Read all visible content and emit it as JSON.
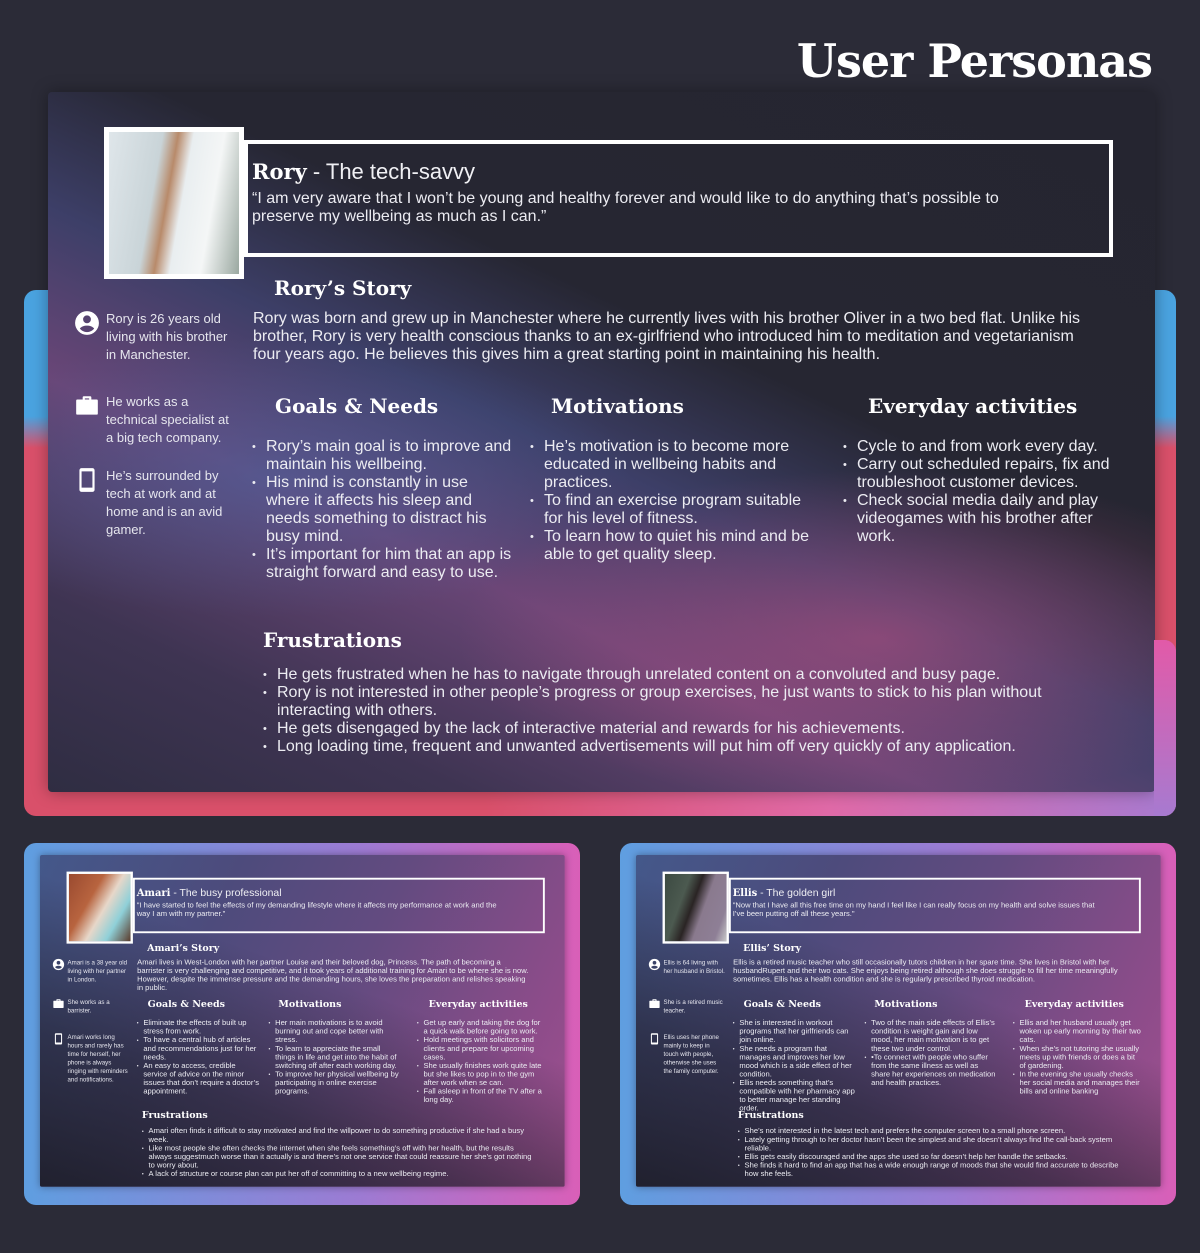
{
  "title": "User Personas",
  "personas": [
    {
      "name": "Rory",
      "tagline": " - The tech-savvy",
      "quote": "“I am very aware that I won’t be young and healthy forever and would like to do anything that’s possible to preserve my wellbeing as much as I can.”",
      "story_title": "Rory’s Story",
      "story": "Rory was born and grew up in Manchester where he currently lives with his brother Oliver in a two bed flat. Unlike his brother, Rory is very health conscious thanks to an ex-girlfriend who introduced him to meditation and vegetarianism four years ago. He believes this gives him a great starting point in maintaining his health.",
      "facts": [
        {
          "icon": "user-circle-icon",
          "text": "Rory is 26 years old living with his brother in Manchester."
        },
        {
          "icon": "briefcase-icon",
          "text": "He works as a technical specialist at a big tech company."
        },
        {
          "icon": "phone-icon",
          "text": "He’s surrounded by tech at work and at home and is an avid gamer."
        }
      ],
      "goals_title": "Goals & Needs",
      "goals": [
        "Rory’s main goal is to improve and maintain his wellbeing.",
        "His mind is constantly in use where it affects his sleep and needs something to distract his busy mind.",
        "It’s important for him that an app is straight forward and easy to use."
      ],
      "motivations_title": "Motivations",
      "motivations": [
        "He’s motivation is to become more educated in wellbeing habits and practices.",
        "To find an exercise program suitable for his level of fitness.",
        "To learn how to quiet his mind and be able to get quality sleep."
      ],
      "activities_title": "Everyday activities",
      "activities": [
        "Cycle to and from work every day.",
        "Carry out scheduled repairs, fix and troubleshoot customer devices.",
        "Check social media daily and play videogames with his brother after work."
      ],
      "frustrations_title": "Frustrations",
      "frustrations": [
        "He gets frustrated when he has to navigate through unrelated content on a convoluted and busy page.",
        "Rory is not interested in other people’s progress or group exercises, he just wants to stick to his plan without interacting with others.",
        "He gets disengaged by the lack of interactive material and rewards for his achievements.",
        "Long loading time, frequent and unwanted advertisements will put him off very quickly of any application."
      ]
    },
    {
      "name": "Amari",
      "tagline": " - The busy professional",
      "quote": "\"I have started to feel the effects of my demanding lifestyle where it affects my performance at work and the way I am with my partner.\"",
      "story_title": "Amari’s Story",
      "story": "Amari lives in West-London with her partner Louise and their beloved dog, Princess. The path of becoming a barrister is very challenging and competitive, and it took years of additional training for Amari to be where she is now. However, despite the immense pressure and the demanding hours, she loves the preparation and relishes speaking in public.",
      "facts": [
        {
          "icon": "user-circle-icon",
          "text": "Amari is a 38 year old living with her partner in London."
        },
        {
          "icon": "briefcase-icon",
          "text": "She works as a barrister."
        },
        {
          "icon": "phone-icon",
          "text": "Amari works long hours and rarely has time for herself, her phone is always ringing with reminders and notifications."
        }
      ],
      "goals_title": "Goals & Needs",
      "goals": [
        "Eliminate the effects of built up stress from work.",
        "To have a central hub of articles and recommendations just for her needs.",
        "An easy to access, credible service of advice on the minor issues that don’t require a doctor’s appointment."
      ],
      "motivations_title": "Motivations",
      "motivations": [
        "Her main motivations is to avoid burning out and cope better with stress.",
        "To learn to appreciate the small things in life and get into the habit of switching off after each working day.",
        "To improve her physical wellbeing by participating in online exercise programs."
      ],
      "activities_title": "Everyday activities",
      "activities": [
        "Get up early and taking the dog for a quick walk before going to work.",
        "Hold meetings with solicitors and clients and prepare for upcoming cases.",
        "She usually finishes work quite late but she likes to pop in to the gym after work when se can.",
        "Fall asleep in front of the TV after a long day."
      ],
      "frustrations_title": "Frustrations",
      "frustrations": [
        "Amari often finds it difficult to stay motivated and find the willpower to do something productive if she had a busy week.",
        "Like most people she often checks the internet when she feels something’s off with her health, but the results always suggestmuch worse than it actually is and there’s not one service that could reassure her she’s got nothing to worry about.",
        "A lack of structure or course plan can put her off of committing to a new wellbeing regime."
      ]
    },
    {
      "name": "Ellis",
      "tagline": " - The golden girl",
      "quote": "\"Now that I have all this free time on my hand I feel like I can really focus on my health and solve issues that I’ve been putting off all these years.\"",
      "story_title": "Ellis’ Story",
      "story": "Ellis is a retired music teacher who still occasionally tutors children in her spare time. She lives in Bristol with her husbandRupert and their two cats. She enjoys being retired although she does struggle to fill her time meaningfully sometimes. Ellis has a health condition and she is regularly prescribed thyroid medication.",
      "facts": [
        {
          "icon": "user-circle-icon",
          "text": "Ellis is 64 living with her husband in Bristol."
        },
        {
          "icon": "briefcase-icon",
          "text": "She is a retired music teacher."
        },
        {
          "icon": "phone-icon",
          "text": "Ellis uses her phone mainly to keep in touch with people, otherwise she uses the family computer."
        }
      ],
      "goals_title": "Goals & Needs",
      "goals": [
        "She is interested in workout programs that her girlfriends can join online.",
        "She needs a program that manages and improves her low mood which is a side effect of her condition.",
        "Ellis needs something that’s compatible with her pharmacy app to better manage her standing order."
      ],
      "motivations_title": "Motivations",
      "motivations": [
        "Two of the main side effects of Ellis’s condition is weight gain and low mood, her main motivation is to get these two under control.",
        "•To connect with people who suffer from the same illness as well as share her experiences on medication and health practices."
      ],
      "activities_title": "Everyday activities",
      "activities": [
        "Ellis and her husband usually get woken up early morning by their two cats.",
        "When she’s not tutoring she usually meets up with friends or does a bit of gardening.",
        "In the evening she usually checks her social media and manages their bills and online banking"
      ],
      "frustrations_title": "Frustrations",
      "frustrations": [
        "She’s not interested in the latest tech and prefers the computer screen to a small phone screen.",
        "Lately getting through to her doctor hasn’t been the simplest and she doesn’t always find the call-back system reliable.",
        "Ellis gets easily discouraged and the apps she used so far doesn’t help her handle the setbacks.",
        "She finds it hard to find an app that has a wide enough range of moods that she would find accurate to describe how she feels."
      ]
    }
  ]
}
